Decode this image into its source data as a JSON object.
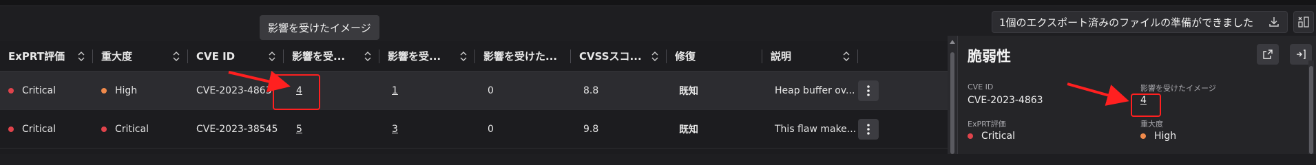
{
  "export_toast": {
    "text": "1個のエクスポート済みのファイルの準備ができました"
  },
  "tooltip": {
    "text": "影響を受けたイメージ"
  },
  "table": {
    "columns": [
      {
        "label": "ExPRT評価"
      },
      {
        "label": "重大度"
      },
      {
        "label": "CVE ID"
      },
      {
        "label": "影響を受..."
      },
      {
        "label": "影響を受..."
      },
      {
        "label": "影響を受けた..."
      },
      {
        "label": "CVSSスコ..."
      },
      {
        "label": "修復"
      },
      {
        "label": "説明"
      }
    ],
    "rows": [
      {
        "exprt": "Critical",
        "exprt_color": "#e0434b",
        "severity": "High",
        "severity_color": "#f08a4b",
        "cve": "CVE-2023-4863",
        "affected_images": "4",
        "affected_2": "1",
        "affected_3": "0",
        "cvss": "8.8",
        "remediation": "既知",
        "description": "Heap buffer ov..."
      },
      {
        "exprt": "Critical",
        "exprt_color": "#e0434b",
        "severity": "Critical",
        "severity_color": "#e0434b",
        "cve": "CVE-2023-38545",
        "affected_images": "5",
        "affected_2": "3",
        "affected_3": "0",
        "cvss": "9.8",
        "remediation": "既知",
        "description": "This flaw make..."
      }
    ]
  },
  "panel": {
    "title": "脆弱性",
    "cve_label": "CVE ID",
    "cve_value": "CVE-2023-4863",
    "images_label": "影響を受けたイメージ",
    "images_value": "4",
    "exprt_label": "ExPRT評価",
    "exprt_value": "Critical",
    "severity_label": "重大度",
    "severity_value": "High"
  },
  "colors": {
    "critical": "#e0434b",
    "high": "#f08a4b",
    "annotation": "#ff2020"
  },
  "icons": [
    "download-icon",
    "collapse-panel-icon",
    "sort-icon",
    "kebab-menu-icon",
    "share-icon",
    "close-panel-icon"
  ]
}
